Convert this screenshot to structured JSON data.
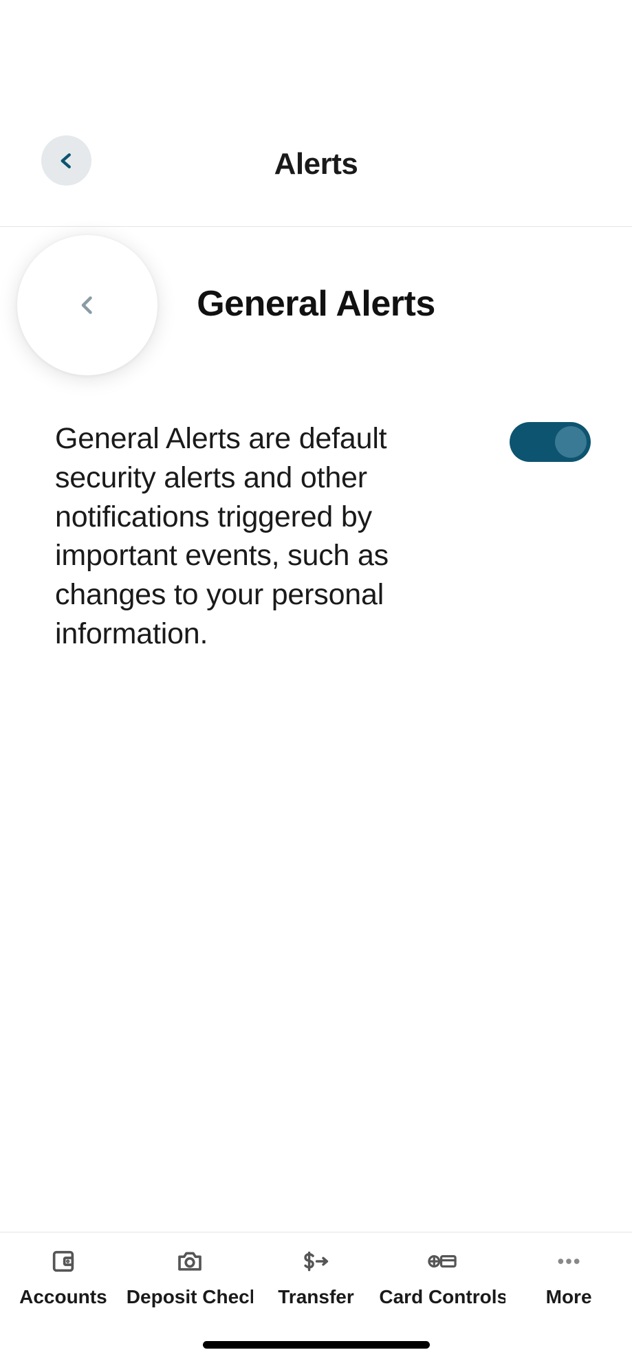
{
  "header": {
    "title": "Alerts"
  },
  "subheader": {
    "title": "General Alerts"
  },
  "content": {
    "description": "General Alerts are default security alerts and other notifications triggered by important events, such as changes to your personal information.",
    "toggle_on": true
  },
  "nav": {
    "items": [
      {
        "label": "Accounts",
        "icon": "wallet-icon"
      },
      {
        "label": "Deposit Check",
        "icon": "camera-icon"
      },
      {
        "label": "Transfer",
        "icon": "dollar-arrow-icon"
      },
      {
        "label": "Card Controls",
        "icon": "card-control-icon"
      },
      {
        "label": "More",
        "icon": "more-icon"
      }
    ]
  }
}
